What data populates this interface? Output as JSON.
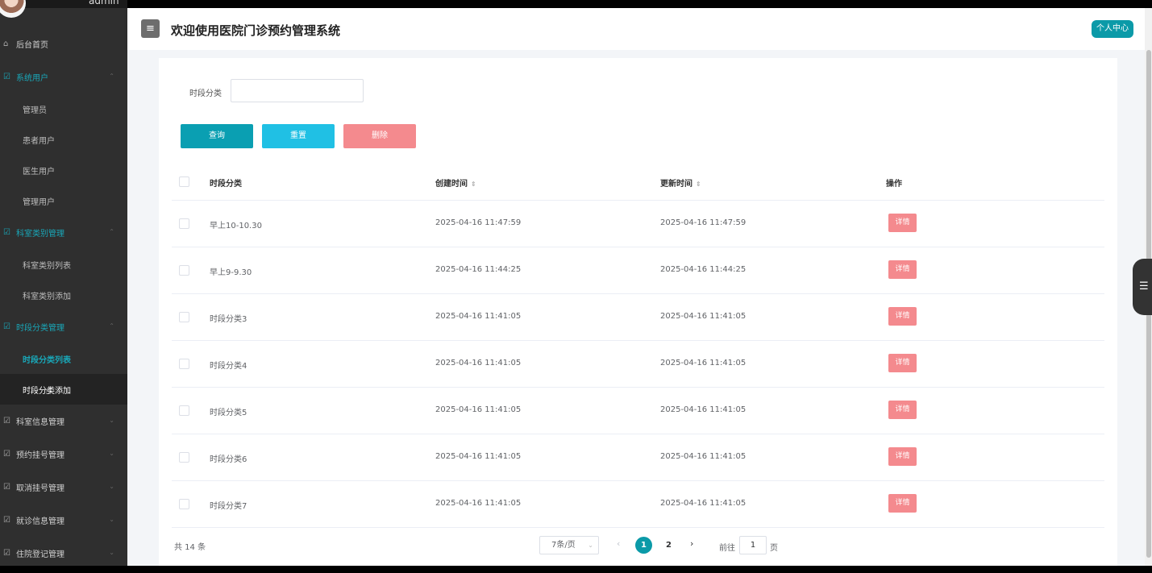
{
  "sidebar": {
    "admin_name": "admin",
    "home": {
      "icon": "home-icon",
      "label": "后台首页"
    },
    "groups": [
      {
        "label": "系统用户",
        "icon": "edit-icon",
        "chevron": "⌃",
        "children": [
          "管理员",
          "患者用户",
          "医生用户",
          "管理用户"
        ]
      },
      {
        "label": "科室类别管理",
        "icon": "edit-icon",
        "chevron": "⌃",
        "children": [
          "科室类别列表",
          "科室类别添加"
        ]
      },
      {
        "label": "时段分类管理",
        "icon": "edit-icon",
        "chevron": "⌃",
        "children": [
          "时段分类列表",
          "时段分类添加"
        ]
      },
      {
        "label": "科室信息管理",
        "icon": "edit-icon",
        "chevron": "⌄",
        "children": []
      },
      {
        "label": "预约挂号管理",
        "icon": "edit-icon",
        "chevron": "⌄",
        "children": []
      },
      {
        "label": "取消挂号管理",
        "icon": "edit-icon",
        "chevron": "⌄",
        "children": []
      },
      {
        "label": "就诊信息管理",
        "icon": "edit-icon",
        "chevron": "⌄",
        "children": []
      },
      {
        "label": "住院登记管理",
        "icon": "edit-icon",
        "chevron": "⌄",
        "children": []
      }
    ],
    "accent_color": "#19a7b8"
  },
  "header": {
    "menu_icon": "hamburger-icon",
    "title": "欢迎使用医院门诊预约管理系统",
    "user_center": "个人中心"
  },
  "search": {
    "label": "时段分类",
    "value": "",
    "buttons": {
      "query": "查询",
      "reset": "重置",
      "delete": "删除"
    }
  },
  "table": {
    "columns": [
      "时段分类",
      "创建时间",
      "更新时间",
      "操作"
    ],
    "rows": [
      {
        "category": "早上10-10.30",
        "created": "2025-04-16 11:47:59",
        "updated": "2025-04-16 11:47:59",
        "action": "详情"
      },
      {
        "category": "早上9-9.30",
        "created": "2025-04-16 11:44:25",
        "updated": "2025-04-16 11:44:25",
        "action": "详情"
      },
      {
        "category": "时段分类3",
        "created": "2025-04-16 11:41:05",
        "updated": "2025-04-16 11:41:05",
        "action": "详情"
      },
      {
        "category": "时段分类4",
        "created": "2025-04-16 11:41:05",
        "updated": "2025-04-16 11:41:05",
        "action": "详情"
      },
      {
        "category": "时段分类5",
        "created": "2025-04-16 11:41:05",
        "updated": "2025-04-16 11:41:05",
        "action": "详情"
      },
      {
        "category": "时段分类6",
        "created": "2025-04-16 11:41:05",
        "updated": "2025-04-16 11:41:05",
        "action": "详情"
      },
      {
        "category": "时段分类7",
        "created": "2025-04-16 11:41:05",
        "updated": "2025-04-16 11:41:05",
        "action": "详情"
      }
    ]
  },
  "pagination": {
    "total": "共 14 条",
    "page_size": "7条/页",
    "pages": [
      "1",
      "2"
    ],
    "current_page": "1",
    "goto_label": "前往",
    "goto_value": "1",
    "goto_unit": "页"
  },
  "colors": {
    "primary": "#0b9aa8",
    "reset": "#20c0e4",
    "danger": "#f48a8e"
  }
}
